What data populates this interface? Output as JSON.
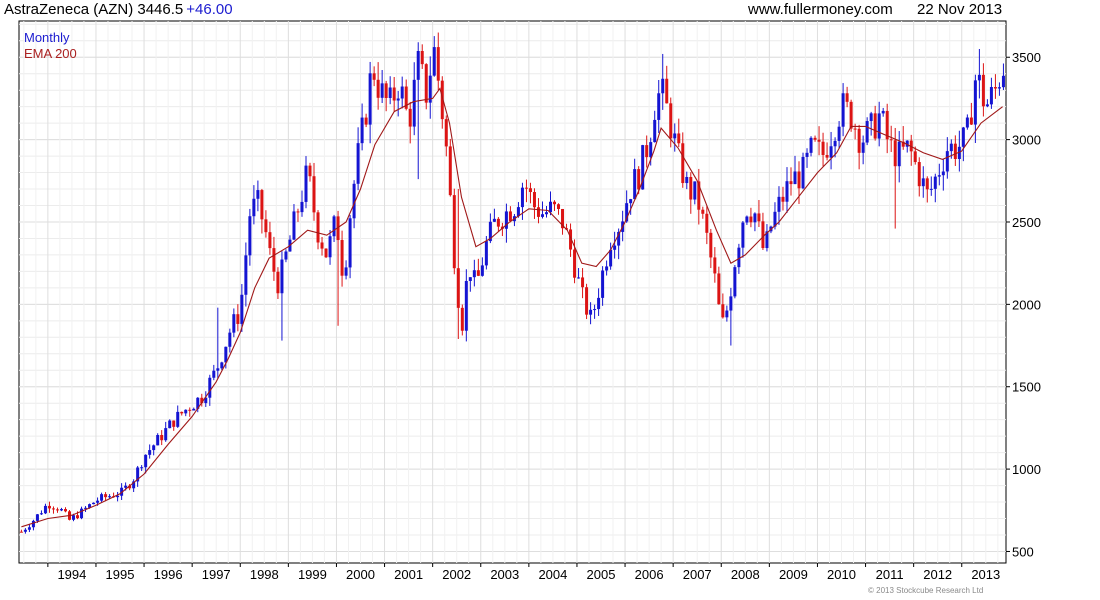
{
  "header": {
    "ticker": "AstraZeneca (AZN) 3446.5",
    "change": "+46.00",
    "site": "www.fullermoney.com",
    "date": "22 Nov 2013"
  },
  "legend": {
    "monthly": "Monthly",
    "ema": "EMA 200"
  },
  "copyright": "© 2013 Stockcube Research Ltd",
  "chart_data": {
    "type": "candlestick",
    "x_ticks": [
      "1994",
      "1995",
      "1996",
      "1997",
      "1998",
      "1999",
      "2000",
      "2001",
      "2002",
      "2003",
      "2004",
      "2005",
      "2006",
      "2007",
      "2008",
      "2009",
      "2010",
      "2011",
      "2012",
      "2013"
    ],
    "x_range": [
      1993.4,
      2013.92
    ],
    "y_ticks": [
      500,
      1000,
      1500,
      2000,
      2500,
      3000,
      3500
    ],
    "ylim": [
      430,
      3720
    ],
    "grid": true,
    "colors": {
      "up": "#1414d2",
      "down": "#dc1414",
      "ema": "#a01818",
      "grid": "#dedede"
    },
    "close_path": [
      [
        1993.45,
        620
      ],
      [
        1993.7,
        690
      ],
      [
        1994.0,
        790
      ],
      [
        1994.25,
        760
      ],
      [
        1994.45,
        690
      ],
      [
        1994.7,
        740
      ],
      [
        1995.0,
        810
      ],
      [
        1995.3,
        840
      ],
      [
        1995.55,
        860
      ],
      [
        1995.8,
        950
      ],
      [
        1996.0,
        1080
      ],
      [
        1996.3,
        1180
      ],
      [
        1996.6,
        1290
      ],
      [
        1996.9,
        1370
      ],
      [
        1997.2,
        1440
      ],
      [
        1997.5,
        1600
      ],
      [
        1997.8,
        1850
      ],
      [
        1998.0,
        1960
      ],
      [
        1998.2,
        2550
      ],
      [
        1998.35,
        2620
      ],
      [
        1998.5,
        2480
      ],
      [
        1998.65,
        2250
      ],
      [
        1998.8,
        2120
      ],
      [
        1999.0,
        2350
      ],
      [
        1999.2,
        2580
      ],
      [
        1999.4,
        2800
      ],
      [
        1999.6,
        2460
      ],
      [
        1999.8,
        2300
      ],
      [
        2000.0,
        2520
      ],
      [
        2000.15,
        2150
      ],
      [
        2000.3,
        2600
      ],
      [
        2000.45,
        2900
      ],
      [
        2000.6,
        3150
      ],
      [
        2000.75,
        3450
      ],
      [
        2000.9,
        3300
      ],
      [
        2001.1,
        3200
      ],
      [
        2001.3,
        3350
      ],
      [
        2001.5,
        3100
      ],
      [
        2001.7,
        3450
      ],
      [
        2001.9,
        3250
      ],
      [
        2002.0,
        3600
      ],
      [
        2002.15,
        3300
      ],
      [
        2002.3,
        2900
      ],
      [
        2002.45,
        2300
      ],
      [
        2002.6,
        1850
      ],
      [
        2002.75,
        2250
      ],
      [
        2002.9,
        2100
      ],
      [
        2003.1,
        2350
      ],
      [
        2003.3,
        2500
      ],
      [
        2003.5,
        2550
      ],
      [
        2003.7,
        2600
      ],
      [
        2003.9,
        2750
      ],
      [
        2004.1,
        2600
      ],
      [
        2004.3,
        2550
      ],
      [
        2004.5,
        2580
      ],
      [
        2004.7,
        2500
      ],
      [
        2004.9,
        2300
      ],
      [
        2005.1,
        2050
      ],
      [
        2005.3,
        1900
      ],
      [
        2005.5,
        2150
      ],
      [
        2005.7,
        2400
      ],
      [
        2005.9,
        2500
      ],
      [
        2006.1,
        2700
      ],
      [
        2006.3,
        2800
      ],
      [
        2006.5,
        3000
      ],
      [
        2006.6,
        3200
      ],
      [
        2006.75,
        3300
      ],
      [
        2006.9,
        3150
      ],
      [
        2007.1,
        2900
      ],
      [
        2007.3,
        2700
      ],
      [
        2007.5,
        2650
      ],
      [
        2007.7,
        2400
      ],
      [
        2007.9,
        2100
      ],
      [
        2008.0,
        1850
      ],
      [
        2008.15,
        2000
      ],
      [
        2008.3,
        2300
      ],
      [
        2008.5,
        2600
      ],
      [
        2008.7,
        2550
      ],
      [
        2008.9,
        2300
      ],
      [
        2009.0,
        2450
      ],
      [
        2009.2,
        2600
      ],
      [
        2009.45,
        2750
      ],
      [
        2009.7,
        2800
      ],
      [
        2009.9,
        2950
      ],
      [
        2010.1,
        2900
      ],
      [
        2010.3,
        3050
      ],
      [
        2010.5,
        3200
      ],
      [
        2010.7,
        3150
      ],
      [
        2010.9,
        3000
      ],
      [
        2011.1,
        3050
      ],
      [
        2011.3,
        3150
      ],
      [
        2011.5,
        2950
      ],
      [
        2011.7,
        2900
      ],
      [
        2011.9,
        2950
      ],
      [
        2012.1,
        2800
      ],
      [
        2012.3,
        2650
      ],
      [
        2012.5,
        2800
      ],
      [
        2012.7,
        2950
      ],
      [
        2012.9,
        2950
      ],
      [
        2013.1,
        3000
      ],
      [
        2013.3,
        3400
      ],
      [
        2013.5,
        3200
      ],
      [
        2013.7,
        3300
      ],
      [
        2013.85,
        3446
      ]
    ],
    "ema_200": [
      [
        1993.45,
        650
      ],
      [
        1994.0,
        700
      ],
      [
        1994.5,
        720
      ],
      [
        1995.0,
        780
      ],
      [
        1995.5,
        850
      ],
      [
        1996.0,
        970
      ],
      [
        1996.5,
        1150
      ],
      [
        1997.0,
        1320
      ],
      [
        1997.5,
        1530
      ],
      [
        1997.75,
        1670
      ],
      [
        1998.0,
        1830
      ],
      [
        1998.3,
        2100
      ],
      [
        1998.6,
        2280
      ],
      [
        1999.0,
        2350
      ],
      [
        1999.4,
        2450
      ],
      [
        1999.8,
        2420
      ],
      [
        2000.2,
        2500
      ],
      [
        2000.5,
        2700
      ],
      [
        2000.8,
        2970
      ],
      [
        2001.2,
        3170
      ],
      [
        2001.6,
        3230
      ],
      [
        2002.0,
        3250
      ],
      [
        2002.15,
        3310
      ],
      [
        2002.35,
        3100
      ],
      [
        2002.6,
        2650
      ],
      [
        2002.9,
        2350
      ],
      [
        2003.2,
        2400
      ],
      [
        2003.6,
        2500
      ],
      [
        2004.0,
        2580
      ],
      [
        2004.4,
        2570
      ],
      [
        2004.8,
        2450
      ],
      [
        2005.1,
        2250
      ],
      [
        2005.4,
        2230
      ],
      [
        2005.7,
        2330
      ],
      [
        2006.0,
        2500
      ],
      [
        2006.3,
        2700
      ],
      [
        2006.6,
        2930
      ],
      [
        2006.75,
        3070
      ],
      [
        2007.1,
        2950
      ],
      [
        2007.5,
        2750
      ],
      [
        2007.9,
        2450
      ],
      [
        2008.2,
        2250
      ],
      [
        2008.5,
        2300
      ],
      [
        2008.9,
        2420
      ],
      [
        2009.2,
        2500
      ],
      [
        2009.6,
        2650
      ],
      [
        2010.0,
        2800
      ],
      [
        2010.4,
        2920
      ],
      [
        2010.7,
        3080
      ],
      [
        2011.0,
        3080
      ],
      [
        2011.4,
        3030
      ],
      [
        2011.8,
        2980
      ],
      [
        2012.2,
        2920
      ],
      [
        2012.6,
        2880
      ],
      [
        2013.0,
        2930
      ],
      [
        2013.4,
        3100
      ],
      [
        2013.85,
        3200
      ]
    ],
    "wick_extremes": [
      [
        1997.55,
        1580,
        1980
      ],
      [
        1998.9,
        1780,
        2200
      ],
      [
        2000.0,
        1870,
        2250
      ],
      [
        2002.5,
        1790,
        2700
      ],
      [
        2001.7,
        2760,
        3300
      ],
      [
        2002.1,
        3450,
        3650
      ],
      [
        2006.8,
        3200,
        3520
      ],
      [
        2008.2,
        1750,
        2100
      ],
      [
        2011.6,
        2460,
        3050
      ],
      [
        2013.35,
        3250,
        3550
      ]
    ]
  }
}
